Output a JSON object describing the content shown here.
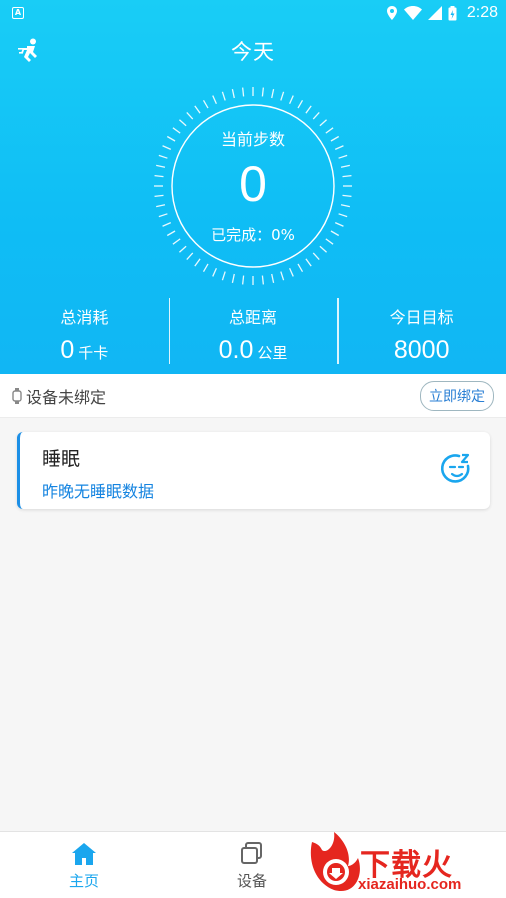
{
  "status_bar": {
    "time": "2:28",
    "app_icon_letter": "A"
  },
  "header": {
    "title": "今天",
    "left_icon": "runner-icon"
  },
  "dial": {
    "label": "当前步数",
    "steps": "0",
    "completion": "已完成：0%"
  },
  "stats": [
    {
      "label": "总消耗",
      "value": "0",
      "unit": "千卡"
    },
    {
      "label": "总距离",
      "value": "0.0",
      "unit": "公里"
    },
    {
      "label": "今日目标",
      "value": "8000",
      "unit": ""
    }
  ],
  "device_bar": {
    "text": "设备未绑定",
    "bind_button": "立即绑定"
  },
  "sleep_card": {
    "title": "睡眠",
    "subtitle": "昨晚无睡眠数据"
  },
  "bottom_nav": [
    {
      "label": "主页",
      "icon": "home-icon",
      "active": true
    },
    {
      "label": "设备",
      "icon": "device-icon",
      "active": false
    }
  ],
  "watermark": {
    "text": "下载火",
    "url": "xiazaihuo.com"
  },
  "colors": {
    "primary": "#11b6f4",
    "accent": "#1584e0",
    "watermark": "#e5261f"
  }
}
